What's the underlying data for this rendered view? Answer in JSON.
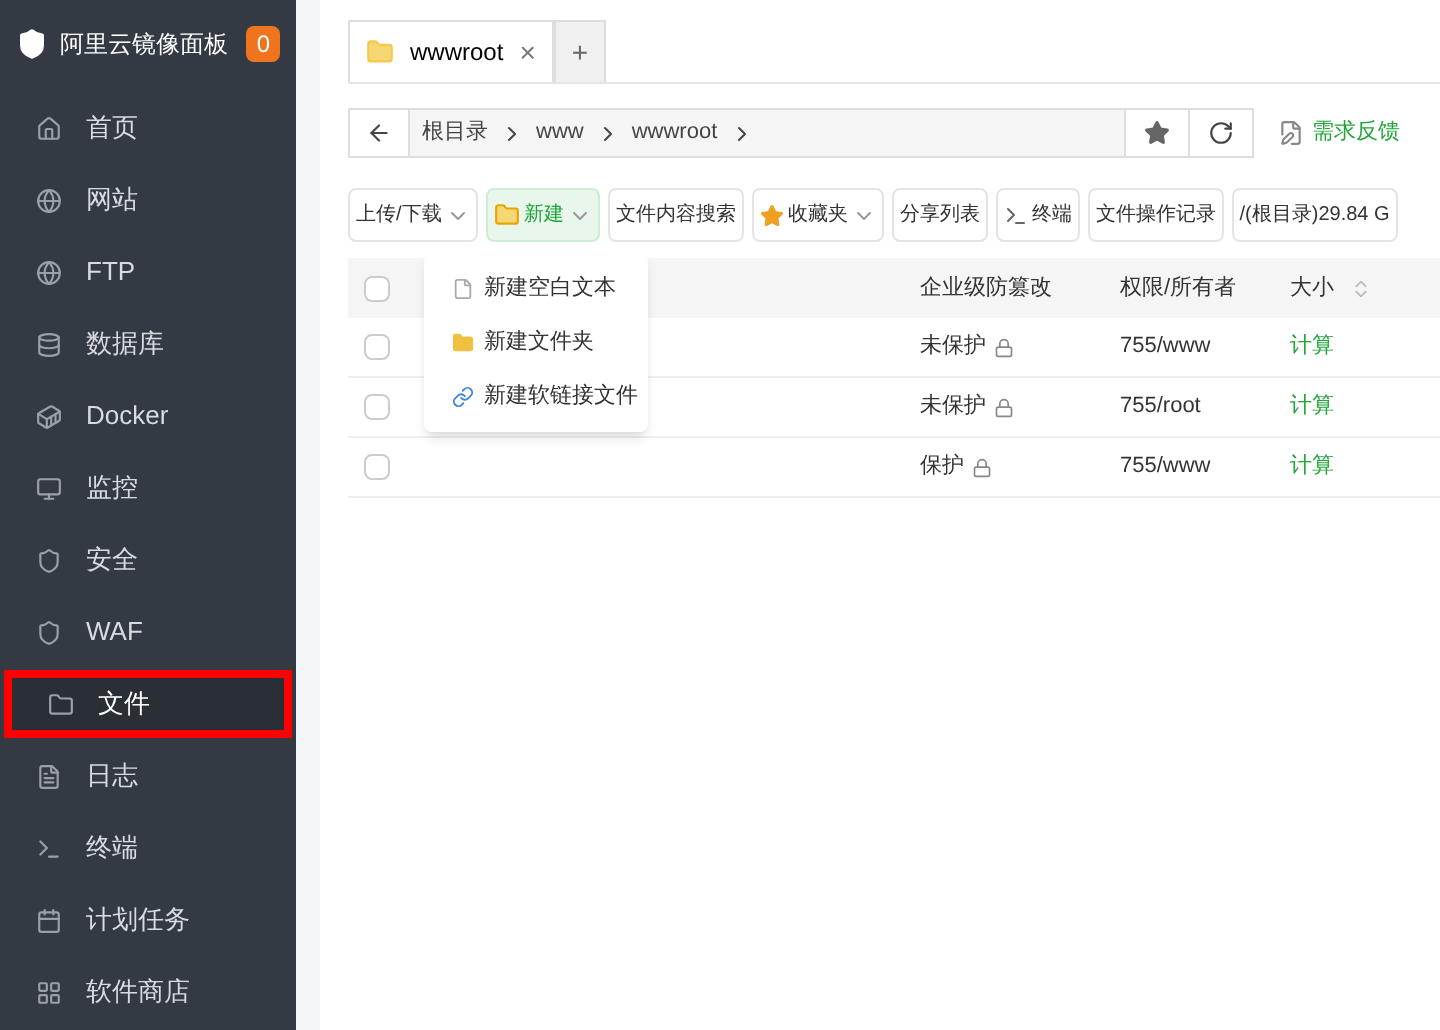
{
  "sidebar": {
    "title": "阿里云镜像面板",
    "badge": "0",
    "items": [
      {
        "label": "首页",
        "selected": false,
        "highlighted": false
      },
      {
        "label": "网站",
        "selected": false,
        "highlighted": false
      },
      {
        "label": "FTP",
        "selected": false,
        "highlighted": false
      },
      {
        "label": "数据库",
        "selected": false,
        "highlighted": false
      },
      {
        "label": "Docker",
        "selected": false,
        "highlighted": false
      },
      {
        "label": "监控",
        "selected": false,
        "highlighted": false
      },
      {
        "label": "安全",
        "selected": false,
        "highlighted": false
      },
      {
        "label": "WAF",
        "selected": false,
        "highlighted": false
      },
      {
        "label": "文件",
        "selected": true,
        "highlighted": true
      },
      {
        "label": "日志",
        "selected": false,
        "highlighted": false
      },
      {
        "label": "终端",
        "selected": false,
        "highlighted": false
      },
      {
        "label": "计划任务",
        "selected": false,
        "highlighted": false
      },
      {
        "label": "软件商店",
        "selected": false,
        "highlighted": false
      }
    ]
  },
  "tabs": [
    {
      "label": "wwwroot",
      "close": "×",
      "selected": true
    }
  ],
  "new_tab": "+",
  "breadcrumb": [
    "根目录",
    "www",
    "wwwroot"
  ],
  "feedback": "需求反馈",
  "toolbar": [
    {
      "label": "上传/下载",
      "kind": "dropdown",
      "active": false
    },
    {
      "label": "新建",
      "kind": "new",
      "active": true
    },
    {
      "label": "文件内容搜索",
      "kind": "plain",
      "active": false
    },
    {
      "label": "收藏夹",
      "kind": "favorites",
      "active": false
    },
    {
      "label": "分享列表",
      "kind": "plain",
      "active": false
    },
    {
      "label": "终端",
      "kind": "terminal",
      "active": false
    },
    {
      "label": "文件操作记录",
      "kind": "plain",
      "active": false
    },
    {
      "label": "/(根目录)29.84 G",
      "kind": "disk",
      "active": false
    }
  ],
  "menu": [
    {
      "label": "新建空白文本"
    },
    {
      "label": "新建文件夹"
    },
    {
      "label": "新建软链接文件"
    }
  ],
  "table": {
    "columns": [
      "企业级防篡改",
      "权限/所有者",
      "大小"
    ],
    "all_checked": false,
    "rows": [
      {
        "checked": false,
        "protection": "未保护",
        "perm": "755/www",
        "size": "计算"
      },
      {
        "checked": false,
        "protection": "未保护",
        "perm": "755/root",
        "size": "计算"
      },
      {
        "checked": false,
        "protection": "保护",
        "perm": "755/www",
        "size": "计算"
      }
    ]
  }
}
